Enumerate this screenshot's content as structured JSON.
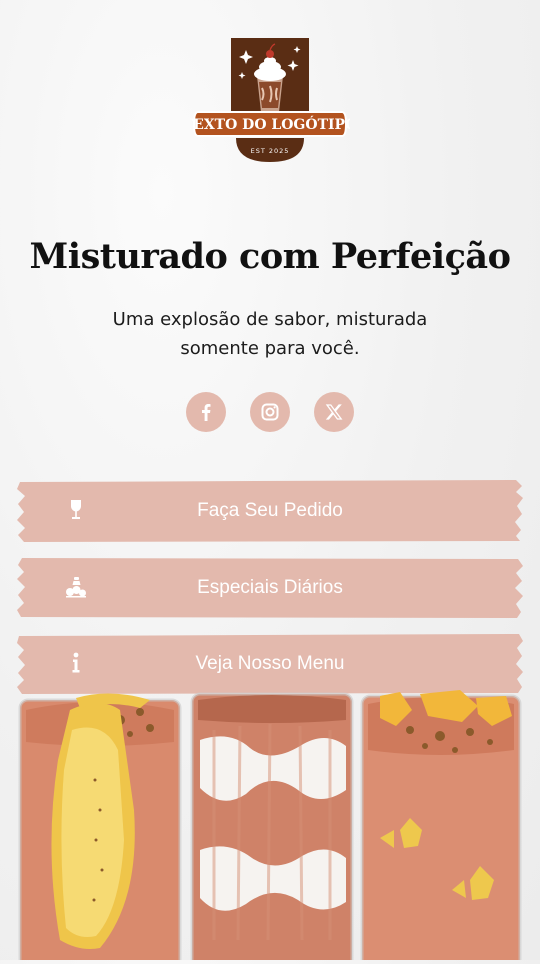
{
  "logo": {
    "text": "TEXTO DO LOGÓTIPO",
    "est": "EST 2025"
  },
  "hero": {
    "title": "Misturado com Perfeição",
    "subtitle_line1": "Uma explosão de sabor, misturada",
    "subtitle_line2": "somente para você."
  },
  "socials": [
    {
      "icon": "facebook-icon"
    },
    {
      "icon": "instagram-icon"
    },
    {
      "icon": "x-icon"
    }
  ],
  "buttons": [
    {
      "label": "Faça Seu Pedido",
      "icon": "wine-glass-icon"
    },
    {
      "label": "Especiais Diários",
      "icon": "fruit-basket-icon"
    },
    {
      "label": "Veja Nosso Menu",
      "icon": "info-icon"
    }
  ],
  "colors": {
    "button_bg": "#e3b9ad",
    "logo_brown": "#5a2d14",
    "logo_orange": "#b3531f",
    "background": "#f1f1f1"
  }
}
